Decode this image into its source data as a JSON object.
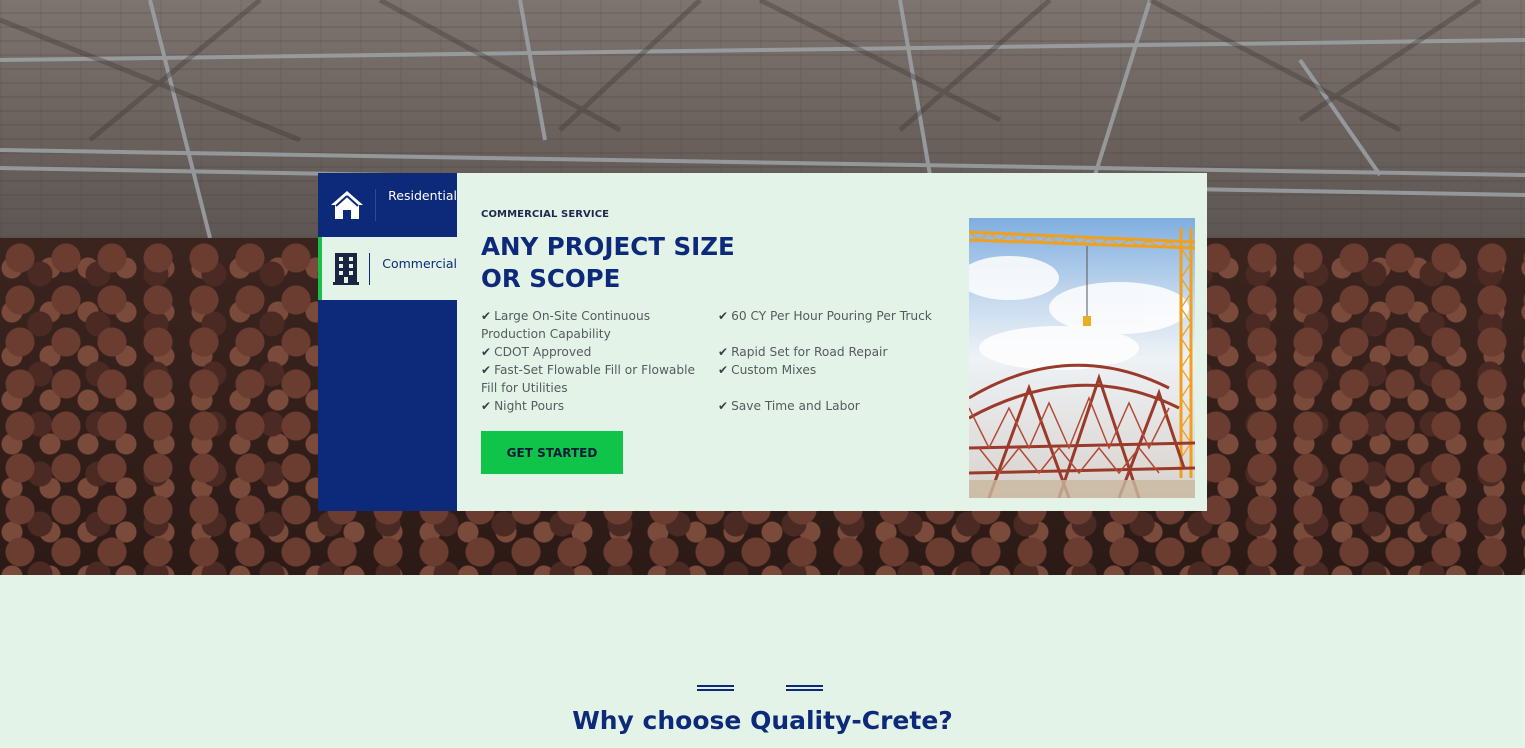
{
  "tabs": [
    {
      "label": "Residential",
      "icon": "home-icon"
    },
    {
      "label": "Commercial",
      "icon": "building-icon"
    }
  ],
  "panel": {
    "eyebrow": "COMMERCIAL SERVICE",
    "headline": "ANY PROJECT SIZE OR SCOPE",
    "features_col1": [
      "Large On-Site Continuous Production Capability",
      "CDOT Approved",
      "Fast-Set Flowable Fill or Flowable Fill for Utilities",
      "Night Pours"
    ],
    "features_col2": [
      "60 CY Per Hour Pouring Per Truck",
      "Rapid Set for Road Repair",
      "Custom Mixes",
      "Save Time and Labor"
    ],
    "check_icon": "check-icon",
    "button_label": "GET STARTED"
  },
  "section": {
    "title": "Why choose Quality-Crete?"
  },
  "colors": {
    "navy": "#0d2a7a",
    "green": "#10c44a",
    "mint": "#e4f3e7"
  }
}
